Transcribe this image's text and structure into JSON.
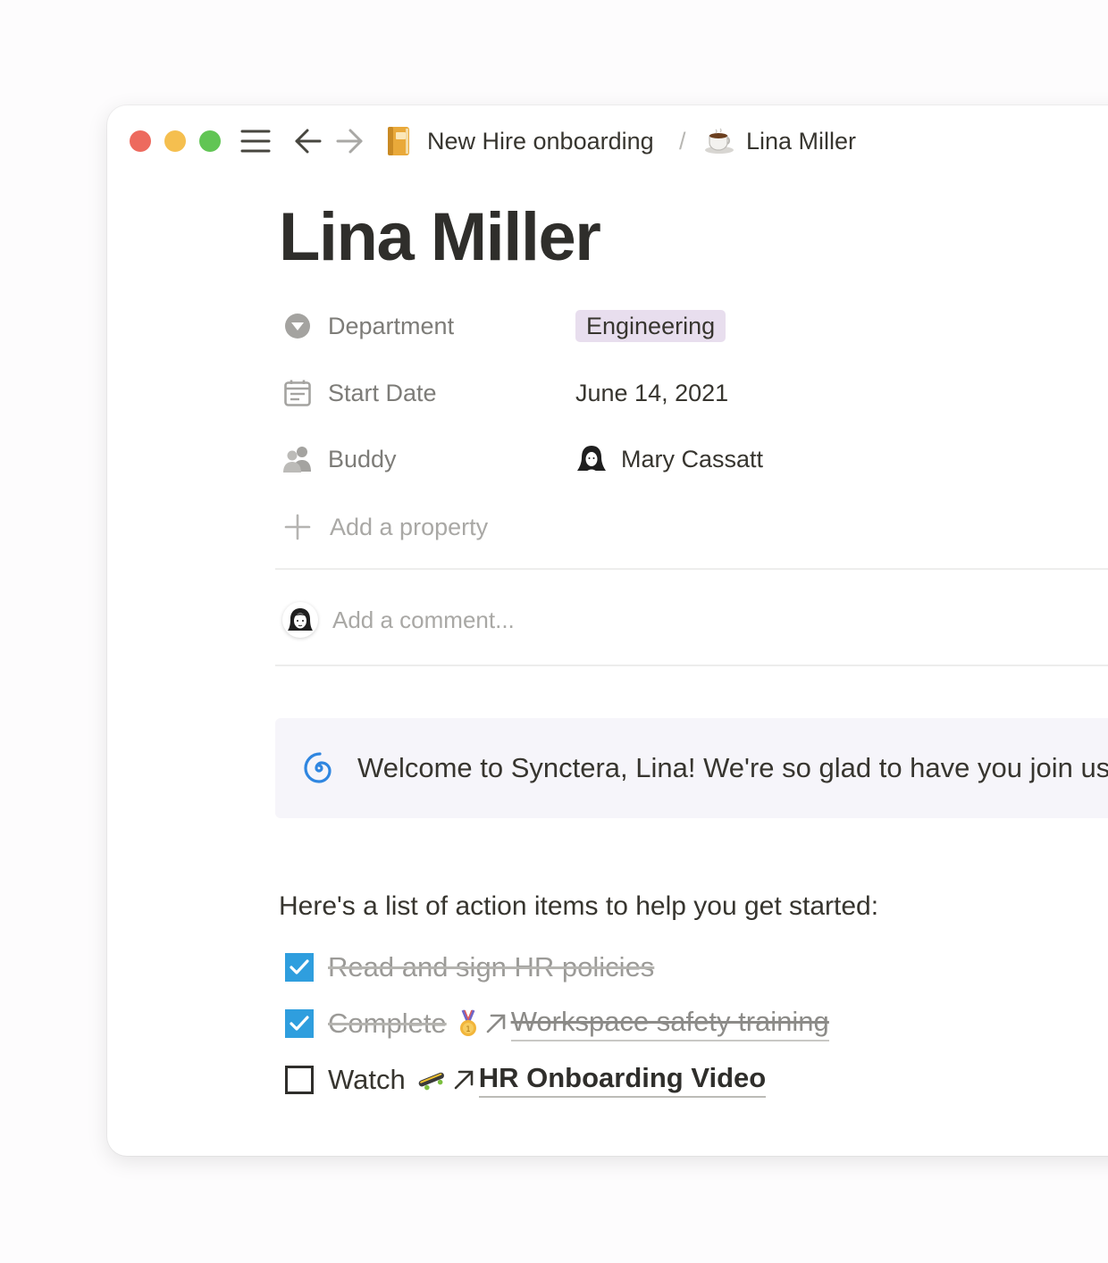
{
  "window": {
    "traffic_lights": {
      "close": "#ed6a5e",
      "minimize": "#f5bf4f",
      "zoom": "#61c554"
    },
    "toolbar": {
      "menu_icon": "hamburger-menu-icon",
      "back_icon": "arrow-left-icon",
      "forward_icon": "arrow-right-icon"
    },
    "breadcrumbs": [
      {
        "icon": "notebook-icon",
        "label": "New Hire onboarding"
      },
      {
        "icon": "coffee-cup-icon",
        "label": "Lina Miller"
      }
    ],
    "breadcrumb_separator": "/"
  },
  "page": {
    "title": "Lina Miller",
    "properties": [
      {
        "icon": "select-chevron-icon",
        "label": "Department",
        "value": "Engineering",
        "value_tag_color": "#e8deee"
      },
      {
        "icon": "calendar-icon",
        "label": "Start Date",
        "value": "June 14, 2021"
      },
      {
        "icon": "people-icon",
        "label": "Buddy",
        "value": "Mary Cassatt",
        "value_icon": "avatar-icon"
      }
    ],
    "add_property_label": "Add a property",
    "comment": {
      "placeholder": "Add a comment..."
    },
    "callout": {
      "icon": "cyclone-emoji-icon",
      "text": "Welcome to Synctera, Lina! We're so glad to have you join us!"
    },
    "list_intro": "Here's a list of action items to help you get started:",
    "todos": [
      {
        "checked": true,
        "text": "Read and sign HR policies"
      },
      {
        "checked": true,
        "text": "Complete",
        "emoji": "medal-icon",
        "link": "Workspace safety training"
      },
      {
        "checked": false,
        "text": "Watch",
        "emoji": "skateboard-icon",
        "link": "HR Onboarding Video"
      }
    ],
    "accent_color": "#2f9ede"
  }
}
